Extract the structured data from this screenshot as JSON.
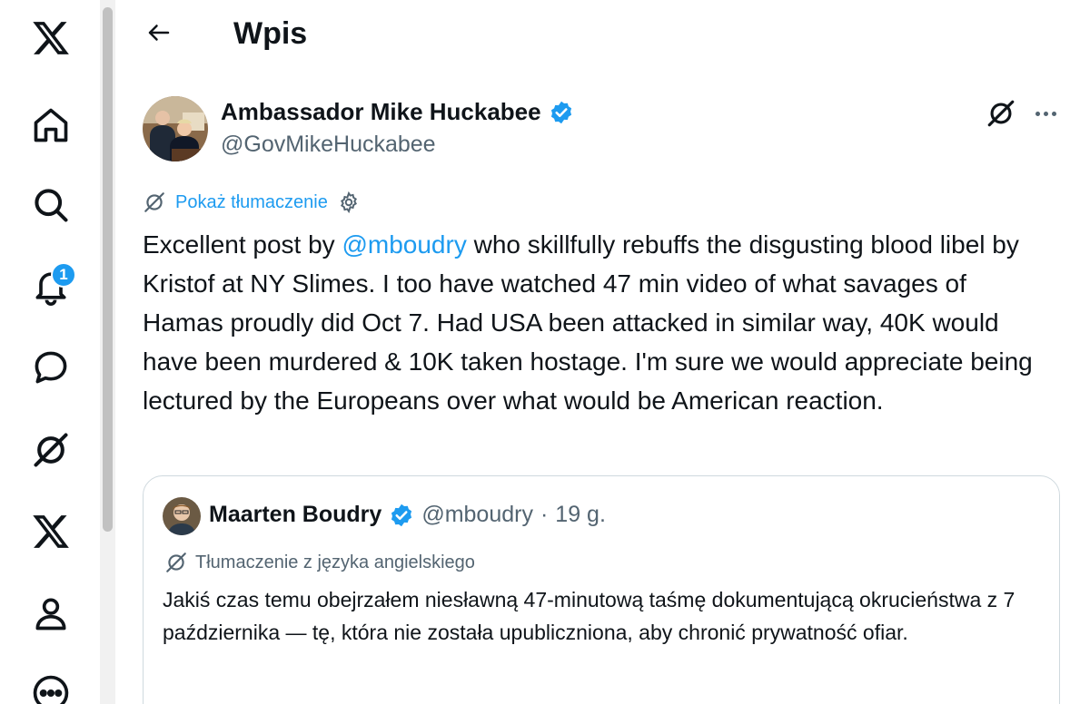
{
  "app": {
    "accent_color": "#1d9bf0",
    "text_color": "#0f1419",
    "secondary_color": "#536471"
  },
  "nav": {
    "items": [
      {
        "name": "x-logo",
        "icon": "x-logo-icon"
      },
      {
        "name": "home",
        "icon": "home-icon"
      },
      {
        "name": "explore",
        "icon": "search-icon"
      },
      {
        "name": "notifications",
        "icon": "bell-icon",
        "badge": "1"
      },
      {
        "name": "messages",
        "icon": "message-icon"
      },
      {
        "name": "grok",
        "icon": "grok-icon"
      },
      {
        "name": "premium",
        "icon": "x-logo-icon"
      },
      {
        "name": "profile",
        "icon": "person-icon"
      },
      {
        "name": "more",
        "icon": "more-circle-icon"
      }
    ]
  },
  "header": {
    "title": "Wpis"
  },
  "tweet": {
    "author_name": "Ambassador Mike Huckabee",
    "author_handle": "@GovMikeHuckabee",
    "translate_label": "Pokaż tłumaczenie",
    "text_before_mention": "Excellent post by ",
    "mention": "@mboudry",
    "text_after_mention": " who skillfully rebuffs the disgusting blood libel by Kristof at NY Slimes.  I too have watched 47 min video of what savages of Hamas proudly did Oct 7.  Had USA been attacked in similar way, 40K would have been murdered & 10K taken hostage. I'm sure we would appreciate being lectured by the Europeans over what would be American reaction."
  },
  "quoted_tweet": {
    "author_name": "Maarten Boudry",
    "author_handle": "@mboudry",
    "separator": "·",
    "time": "19 g.",
    "translation_label": "Tłumaczenie z języka angielskiego",
    "text": "Jakiś czas temu obejrzałem niesławną 47-minutową taśmę dokumentującą okrucieństwa z 7 października — tę, która nie została upubliczniona, aby chronić prywatność ofiar."
  }
}
